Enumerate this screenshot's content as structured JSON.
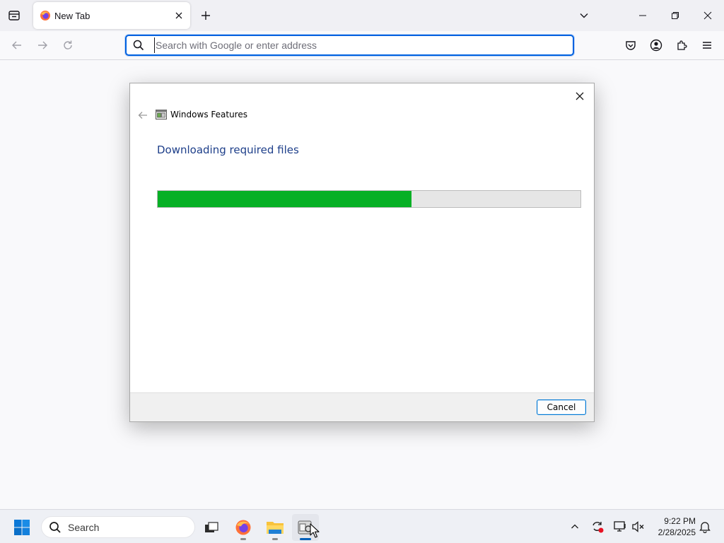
{
  "browser": {
    "tab": {
      "title": "New Tab"
    },
    "urlbar": {
      "placeholder": "Search with Google or enter address",
      "value": ""
    }
  },
  "dialog": {
    "app_title": "Windows Features",
    "heading": "Downloading required files",
    "progress_fraction": 0.6,
    "cancel_label": "Cancel"
  },
  "taskbar": {
    "search_label": "Search",
    "clock": {
      "time": "9:22 PM",
      "date": "2/28/2025"
    }
  },
  "colors": {
    "progress_fill": "#06b025",
    "heading_blue": "#1e3f8a",
    "urlbar_focus": "#0061e0",
    "firefox_orange": "#ff7139"
  },
  "icons": {
    "tab_list": "tab-list-icon",
    "favicon": "firefox-icon",
    "pocket": "pocket-icon",
    "account": "account-icon",
    "extensions": "extensions-icon",
    "menu": "hamburger-menu-icon",
    "dialog_app": "windows-features-icon",
    "tray": [
      "chevron-up-icon",
      "sync-icon",
      "network-icon",
      "volume-muted-icon",
      "notifications-icon"
    ]
  }
}
